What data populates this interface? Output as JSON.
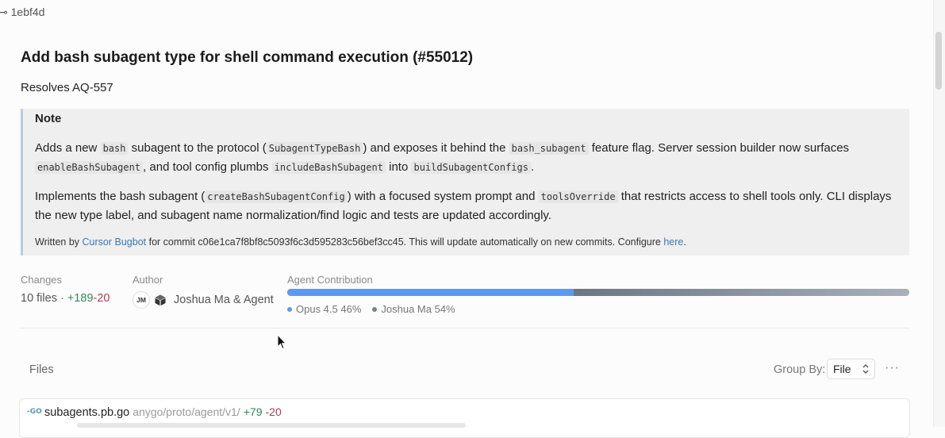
{
  "commit": {
    "ref": "1ebf4d",
    "prefix": "⊸"
  },
  "pr": {
    "title": "Add bash subagent type for shell command execution (#55012)",
    "resolves": "Resolves AQ-557"
  },
  "note": {
    "heading": "Note",
    "p1": {
      "t1": "Adds a new ",
      "c1": "bash",
      "t2": " subagent to the protocol (",
      "c2": "SubagentTypeBash",
      "t3": ") and exposes it behind the ",
      "c3": "bash_subagent",
      "t4": " feature flag. Server session builder now surfaces ",
      "c4": "enableBashSubagent",
      "t5": ", and tool config plumbs ",
      "c5": "includeBashSubagent",
      "t6": " into ",
      "c6": "buildSubagentConfigs",
      "t7": "."
    },
    "p2": {
      "t1": "Implements the bash subagent (",
      "c1": "createBashSubagentConfig",
      "t2": ") with a focused system prompt and ",
      "c2": "toolsOverride",
      "t3": " that restricts access to shell tools only. CLI displays the new type label, and subagent name normalization/find logic and tests are updated accordingly."
    },
    "footer": {
      "written_by": "Written by ",
      "bot_name": "Cursor Bugbot",
      "for_commit": " for commit c06e1ca7f8bf8c5093f6c3d595283c56bef3cc45. This will update automatically on new commits. Configure ",
      "here": "here",
      "end": "."
    }
  },
  "meta": {
    "changes_label": "Changes",
    "changes_files": "10 files · ",
    "changes_add": "+189",
    "changes_del": "-20",
    "author_label": "Author",
    "author_initials": "JM",
    "author_name": "Joshua Ma & Agent",
    "contribution_label": "Agent Contribution",
    "contribution": [
      {
        "name": "Opus 4.5 46%",
        "fraction": 0.46,
        "color": "#5a9bf0"
      },
      {
        "name": "Joshua Ma 54%",
        "fraction": 0.54,
        "color": "#7b808a"
      }
    ]
  },
  "files": {
    "label": "Files",
    "group_by_label": "Group By:",
    "group_by_value": "File",
    "more": "···",
    "items": [
      {
        "icon": "-GO",
        "name": "subagents.pb.go",
        "path": "anygo/proto/agent/v1/",
        "add": "+79",
        "del": "-20"
      }
    ]
  },
  "colors": {
    "accent_link": "#3a78b5",
    "additions": "#2e8a57",
    "deletions": "#b03e57"
  }
}
